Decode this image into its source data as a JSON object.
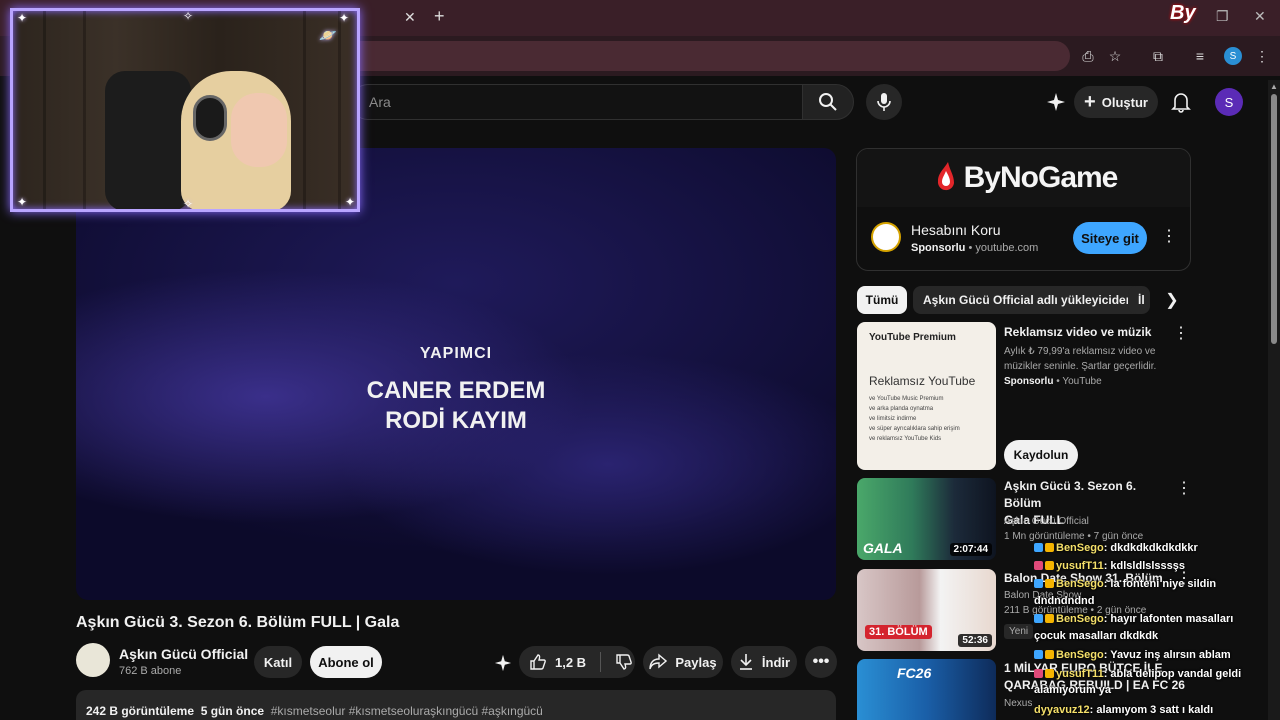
{
  "browser": {
    "tab_close": "✕",
    "new_tab": "+",
    "profile_initial": "S",
    "watermark": "By"
  },
  "header": {
    "search_placeholder": "Ara",
    "create_label": "Oluştur",
    "avatar_initial": "S"
  },
  "video": {
    "credit_role": "YAPIMCI",
    "credit_names": [
      "CANER ERDEM",
      "RODİ KAYIM"
    ],
    "title": "Aşkın Gücü 3. Sezon 6. Bölüm FULL | Gala",
    "channel_name": "Aşkın Gücü Official",
    "subscribers": "762 B abone",
    "join_label": "Katıl",
    "subscribe_label": "Abone ol",
    "likes": "1,2 B",
    "share_label": "Paylaş",
    "download_label": "İndir",
    "views": "242 B görüntüleme",
    "age": "5 gün önce",
    "hashtags": "#kısmetseolur #kısmetseoluraşkıngücü #aşkıngücü"
  },
  "ad": {
    "brand": "ByNoGame",
    "title": "Hesabını Koru",
    "sponsored": "Sponsorlu",
    "domain": "youtube.com",
    "cta": "Siteye git"
  },
  "chips": [
    "Tümü",
    "Aşkın Gücü Official adlı yükleyiciden",
    "İl"
  ],
  "recommendations": [
    {
      "title": "Reklamsız video ve müzik",
      "line1": "Aylık ₺ 79,99'a reklamsız video ve",
      "line2": "müzikler seninle. Şartlar geçerlidir.",
      "sponsored": "Sponsorlu",
      "source": "YouTube",
      "cta": "Kaydolun",
      "thumb_logo": "YouTube Premium",
      "thumb_heading": "Reklamsız YouTube",
      "thumb_list": [
        "ve YouTube Music Premium",
        "ve arka planda oynatma",
        "ve limitsiz indirme",
        "ve süper ayrıcalıklara sahip erişim",
        "ve reklamsız YouTube Kids"
      ]
    },
    {
      "title_line1": "Aşkın Gücü 3. Sezon 6. Bölüm",
      "title_line2": "Gala FULL",
      "channel": "Aşkın Gücü Official",
      "meta": "1 Mn görüntüleme • 7 gün önce",
      "duration": "2:07:44",
      "thumb_label": "GALA"
    },
    {
      "title": "Balon Date Show 31. Bölüm",
      "channel": "Balon Date Show",
      "meta": "211 B görüntüleme • 2 gün önce",
      "badge": "Yeni",
      "duration": "52:36",
      "thumb_label": "31. BÖLÜM"
    },
    {
      "title_line1": "1 MİLYAR EURO BÜTÇE İLE",
      "title_line2": "QARABAG REBUILD | EA FC 26",
      "channel": "Nexus",
      "thumb_label": "FC26"
    }
  ],
  "chat": [
    {
      "user": "BenSego",
      "text": ": dkdkdkdkdkdkkr"
    },
    {
      "user": "yusufT11",
      "text": ": kdlsldlslsssşs"
    },
    {
      "user": "BenSego",
      "text": ": la fonteni niye sildin"
    },
    {
      "user": "",
      "text": "dndndndnd"
    },
    {
      "user": "BenSego",
      "text": ": hayır lafonten masalları"
    },
    {
      "user": "",
      "text": "çocuk masalları dkdkdk"
    },
    {
      "user": "BenSego",
      "text": ": Yavuz inş alırsın ablam"
    },
    {
      "user": "yusufT11",
      "text": ": abla delipop vandal geldi"
    },
    {
      "user": "",
      "text": "alamıyorum ya"
    },
    {
      "user": "dyyavuz12",
      "text": ": alamıyom 3 satt ı kaldı"
    }
  ]
}
